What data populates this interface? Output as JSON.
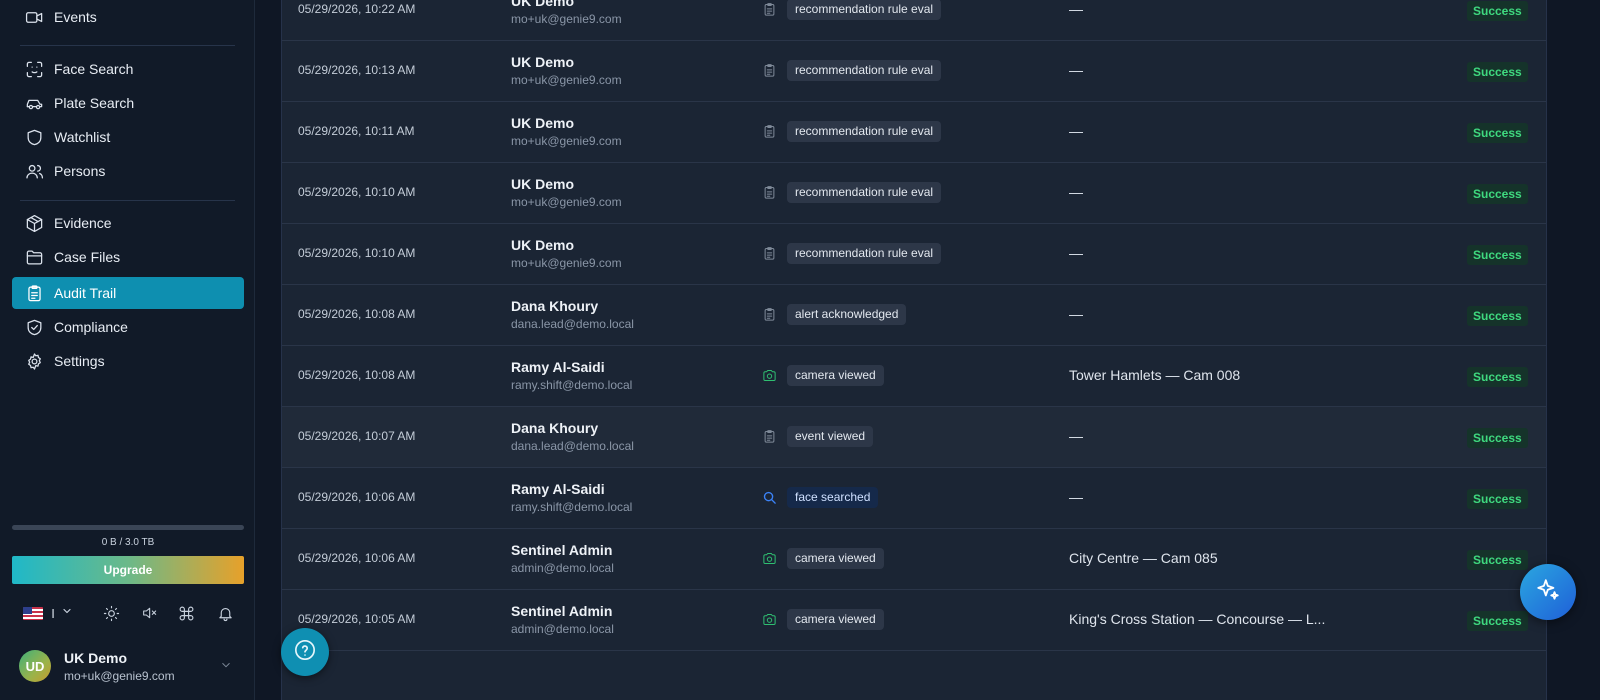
{
  "sidebar": {
    "items": [
      {
        "label": "Events",
        "icon": "video-camera-icon"
      },
      {
        "label": "Face Search",
        "icon": "face-scan-icon"
      },
      {
        "label": "Plate Search",
        "icon": "car-icon"
      },
      {
        "label": "Watchlist",
        "icon": "shield-icon"
      },
      {
        "label": "Persons",
        "icon": "users-icon"
      },
      {
        "label": "Evidence",
        "icon": "cube-icon"
      },
      {
        "label": "Case Files",
        "icon": "folder-icon"
      },
      {
        "label": "Audit Trail",
        "icon": "clipboard-icon",
        "active": true
      },
      {
        "label": "Compliance",
        "icon": "shield-check-icon"
      },
      {
        "label": "Settings",
        "icon": "gear-icon"
      }
    ],
    "storage": {
      "text": "0 B / 3.0 TB",
      "used_fraction": 0
    },
    "upgrade_label": "Upgrade",
    "language_separator": "I",
    "user": {
      "initials": "UD",
      "name": "UK Demo",
      "email": "mo+uk@genie9.com"
    }
  },
  "audit": {
    "rows": [
      {
        "date": "05/29/2026, 10:22 AM",
        "name": "UK Demo",
        "email": "mo+uk@genie9.com",
        "icon": "clipboard-icon",
        "action": "recommendation rule eval",
        "resource": "—",
        "status": "Success"
      },
      {
        "date": "05/29/2026, 10:13 AM",
        "name": "UK Demo",
        "email": "mo+uk@genie9.com",
        "icon": "clipboard-icon",
        "action": "recommendation rule eval",
        "resource": "—",
        "status": "Success"
      },
      {
        "date": "05/29/2026, 10:11 AM",
        "name": "UK Demo",
        "email": "mo+uk@genie9.com",
        "icon": "clipboard-icon",
        "action": "recommendation rule eval",
        "resource": "—",
        "status": "Success"
      },
      {
        "date": "05/29/2026, 10:10 AM",
        "name": "UK Demo",
        "email": "mo+uk@genie9.com",
        "icon": "clipboard-icon",
        "action": "recommendation rule eval",
        "resource": "—",
        "status": "Success"
      },
      {
        "date": "05/29/2026, 10:10 AM",
        "name": "UK Demo",
        "email": "mo+uk@genie9.com",
        "icon": "clipboard-icon",
        "action": "recommendation rule eval",
        "resource": "—",
        "status": "Success"
      },
      {
        "date": "05/29/2026, 10:08 AM",
        "name": "Dana Khoury",
        "email": "dana.lead@demo.local",
        "icon": "clipboard-icon",
        "action": "alert acknowledged",
        "resource": "—",
        "status": "Success"
      },
      {
        "date": "05/29/2026, 10:08 AM",
        "name": "Ramy Al-Saidi",
        "email": "ramy.shift@demo.local",
        "icon": "camera-icon",
        "action": "camera viewed",
        "resource": "Tower Hamlets — Cam 008",
        "status": "Success"
      },
      {
        "date": "05/29/2026, 10:07 AM",
        "name": "Dana Khoury",
        "email": "dana.lead@demo.local",
        "icon": "clipboard-icon",
        "action": "event viewed",
        "resource": "—",
        "status": "Success",
        "highlight": true
      },
      {
        "date": "05/29/2026, 10:06 AM",
        "name": "Ramy Al-Saidi",
        "email": "ramy.shift@demo.local",
        "icon": "search-icon",
        "action": "face searched",
        "resource": "—",
        "status": "Success"
      },
      {
        "date": "05/29/2026, 10:06 AM",
        "name": "Sentinel Admin",
        "email": "admin@demo.local",
        "icon": "camera-icon",
        "action": "camera viewed",
        "resource": "City Centre — Cam 085",
        "status": "Success"
      },
      {
        "date": "05/29/2026, 10:05 AM",
        "name": "Sentinel Admin",
        "email": "admin@demo.local",
        "icon": "camera-icon",
        "action": "camera viewed",
        "resource": "King's Cross Station — Concourse — L...",
        "status": "Success"
      }
    ]
  },
  "colors": {
    "accent": "#0e8fb0",
    "success": "#3fd97f",
    "camera": "#2fbf71",
    "search": "#3b82f6"
  }
}
